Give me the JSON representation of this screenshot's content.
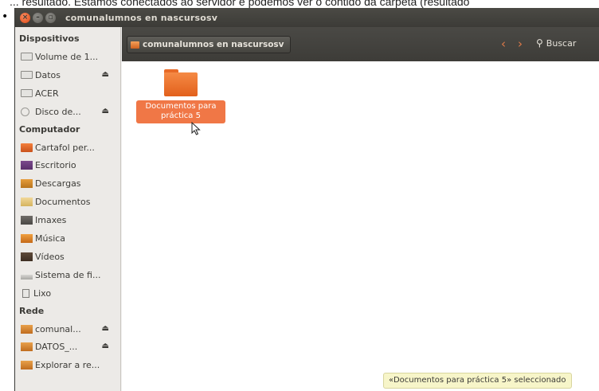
{
  "document": {
    "bullet": "•",
    "intro_text": "... resultado. Estamos conectados ao servidor e podemos ver o contido da carpeta (resultado"
  },
  "window": {
    "title": "comunalumnos en nascursosv",
    "buttons": [
      "close",
      "minimize",
      "maximize"
    ]
  },
  "sidebar": {
    "sections": [
      {
        "heading": "Dispositivos",
        "items": [
          {
            "label": "Volume de 1...",
            "icon": "drive-icon",
            "eject": false
          },
          {
            "label": "Datos",
            "icon": "drive-icon",
            "eject": true
          },
          {
            "label": "ACER",
            "icon": "drive-icon",
            "eject": false
          },
          {
            "label": "Disco de...",
            "icon": "disc-icon",
            "eject": true
          }
        ]
      },
      {
        "heading": "Computador",
        "items": [
          {
            "label": "Cartafol per...",
            "icon": "home-folder-icon",
            "eject": false
          },
          {
            "label": "Escritorio",
            "icon": "desktop-icon",
            "eject": false
          },
          {
            "label": "Descargas",
            "icon": "downloads-icon",
            "eject": false
          },
          {
            "label": "Documentos",
            "icon": "documents-icon",
            "eject": false
          },
          {
            "label": "Imaxes",
            "icon": "pictures-icon",
            "eject": false
          },
          {
            "label": "Música",
            "icon": "music-icon",
            "eject": false
          },
          {
            "label": "Vídeos",
            "icon": "videos-icon",
            "eject": false
          },
          {
            "label": "Sistema de fi...",
            "icon": "filesystem-icon",
            "eject": false
          },
          {
            "label": "Lixo",
            "icon": "trash-icon",
            "eject": false
          }
        ]
      },
      {
        "heading": "Rede",
        "items": [
          {
            "label": "comunal...",
            "icon": "network-share-icon",
            "eject": true
          },
          {
            "label": "DATOS_...",
            "icon": "network-share-icon",
            "eject": true
          },
          {
            "label": "Explorar a re...",
            "icon": "network-icon",
            "eject": false
          }
        ]
      }
    ]
  },
  "toolbar": {
    "path_label": "comunalumnos en nascursosv",
    "back_icon": "‹",
    "forward_icon": "›",
    "search_label": "Buscar"
  },
  "content": {
    "files": [
      {
        "name": "Documentos para práctica 5",
        "icon": "folder-icon",
        "selected": true
      }
    ]
  },
  "status": {
    "text": "«Documentos para práctica 5» seleccionado"
  },
  "colors": {
    "accent": "#f07746",
    "titlebar": "#3c3b37",
    "sidebar": "#eceae7"
  }
}
